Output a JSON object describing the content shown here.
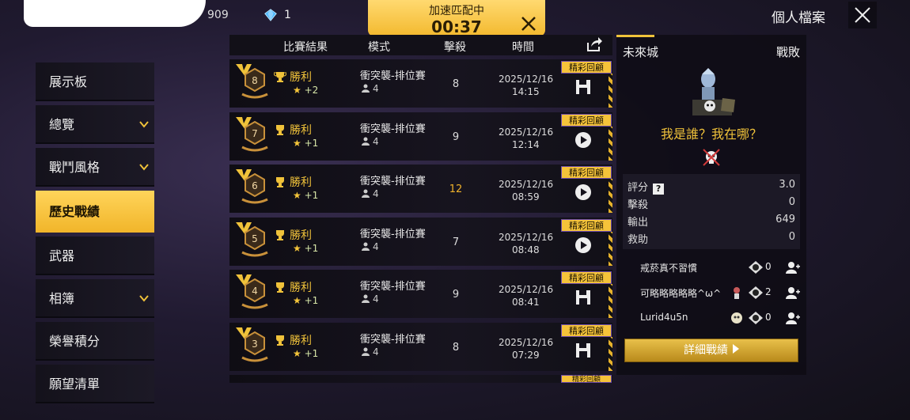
{
  "topbar": {
    "coin_value": "909",
    "diamond_value": "1",
    "match_status": "加速匹配中",
    "match_timer": "00:37",
    "profile_title": "個人檔案"
  },
  "sidebar": {
    "items": [
      {
        "label": "展示板",
        "has_chevron": false,
        "active": false
      },
      {
        "label": "總覽",
        "has_chevron": true,
        "active": false
      },
      {
        "label": "戰鬥風格",
        "has_chevron": true,
        "active": false
      },
      {
        "label": "歷史戰績",
        "has_chevron": false,
        "active": true
      },
      {
        "label": "武器",
        "has_chevron": false,
        "active": false
      },
      {
        "label": "相簿",
        "has_chevron": true,
        "active": false
      },
      {
        "label": "榮譽積分",
        "has_chevron": false,
        "active": false
      },
      {
        "label": "願望清單",
        "has_chevron": false,
        "active": false
      }
    ]
  },
  "table": {
    "headers": {
      "result": "比賽結果",
      "mode": "模式",
      "kills": "擊殺",
      "time": "時間"
    },
    "rows": [
      {
        "rank": "8",
        "result": "勝利",
        "stars": "+2",
        "mode": "衝突襲-排位賽",
        "party": "4",
        "kills": "8",
        "date": "2025/12/16",
        "time": "14:15",
        "tag": "精彩回顧",
        "action": "save",
        "kills_highlight": false
      },
      {
        "rank": "7",
        "result": "勝利",
        "stars": "+1",
        "mode": "衝突襲-排位賽",
        "party": "4",
        "kills": "9",
        "date": "2025/12/16",
        "time": "12:14",
        "tag": "精彩回顧",
        "action": "play",
        "kills_highlight": false
      },
      {
        "rank": "6",
        "result": "勝利",
        "stars": "+1",
        "mode": "衝突襲-排位賽",
        "party": "4",
        "kills": "12",
        "date": "2025/12/16",
        "time": "08:59",
        "tag": "精彩回顧",
        "action": "play",
        "kills_highlight": true
      },
      {
        "rank": "5",
        "result": "勝利",
        "stars": "+1",
        "mode": "衝突襲-排位賽",
        "party": "4",
        "kills": "7",
        "date": "2025/12/16",
        "time": "08:48",
        "tag": "精彩回顧",
        "action": "play",
        "kills_highlight": false
      },
      {
        "rank": "4",
        "result": "勝利",
        "stars": "+1",
        "mode": "衝突襲-排位賽",
        "party": "4",
        "kills": "9",
        "date": "2025/12/16",
        "time": "08:41",
        "tag": "精彩回顧",
        "action": "save",
        "kills_highlight": false
      },
      {
        "rank": "3",
        "result": "勝利",
        "stars": "+1",
        "mode": "衝突襲-排位賽",
        "party": "4",
        "kills": "8",
        "date": "2025/12/16",
        "time": "07:29",
        "tag": "精彩回顧",
        "action": "save",
        "kills_highlight": false
      }
    ],
    "partial_row_tag": "精彩回顧"
  },
  "detail": {
    "map": "未來城",
    "outcome": "戰敗",
    "player_title": "我是誰？我在哪？",
    "stats": [
      {
        "label": "評分",
        "value": "3.0",
        "help": true
      },
      {
        "label": "擊殺",
        "value": "0",
        "help": false
      },
      {
        "label": "輸出",
        "value": "649",
        "help": false
      },
      {
        "label": "救助",
        "value": "0",
        "help": false
      }
    ],
    "teammates": [
      {
        "name": "戒菸真不習慣",
        "kills": "0",
        "extra": false
      },
      {
        "name": "可略略略略略^ω^",
        "kills": "2",
        "extra": true
      },
      {
        "name": "Lurid4u5n",
        "kills": "0",
        "extra": true
      }
    ],
    "detail_button": "詳細戰績"
  },
  "colors": {
    "accent": "#f0c23a",
    "panel_bg": "#14121b",
    "text": "#e8e8ee"
  }
}
